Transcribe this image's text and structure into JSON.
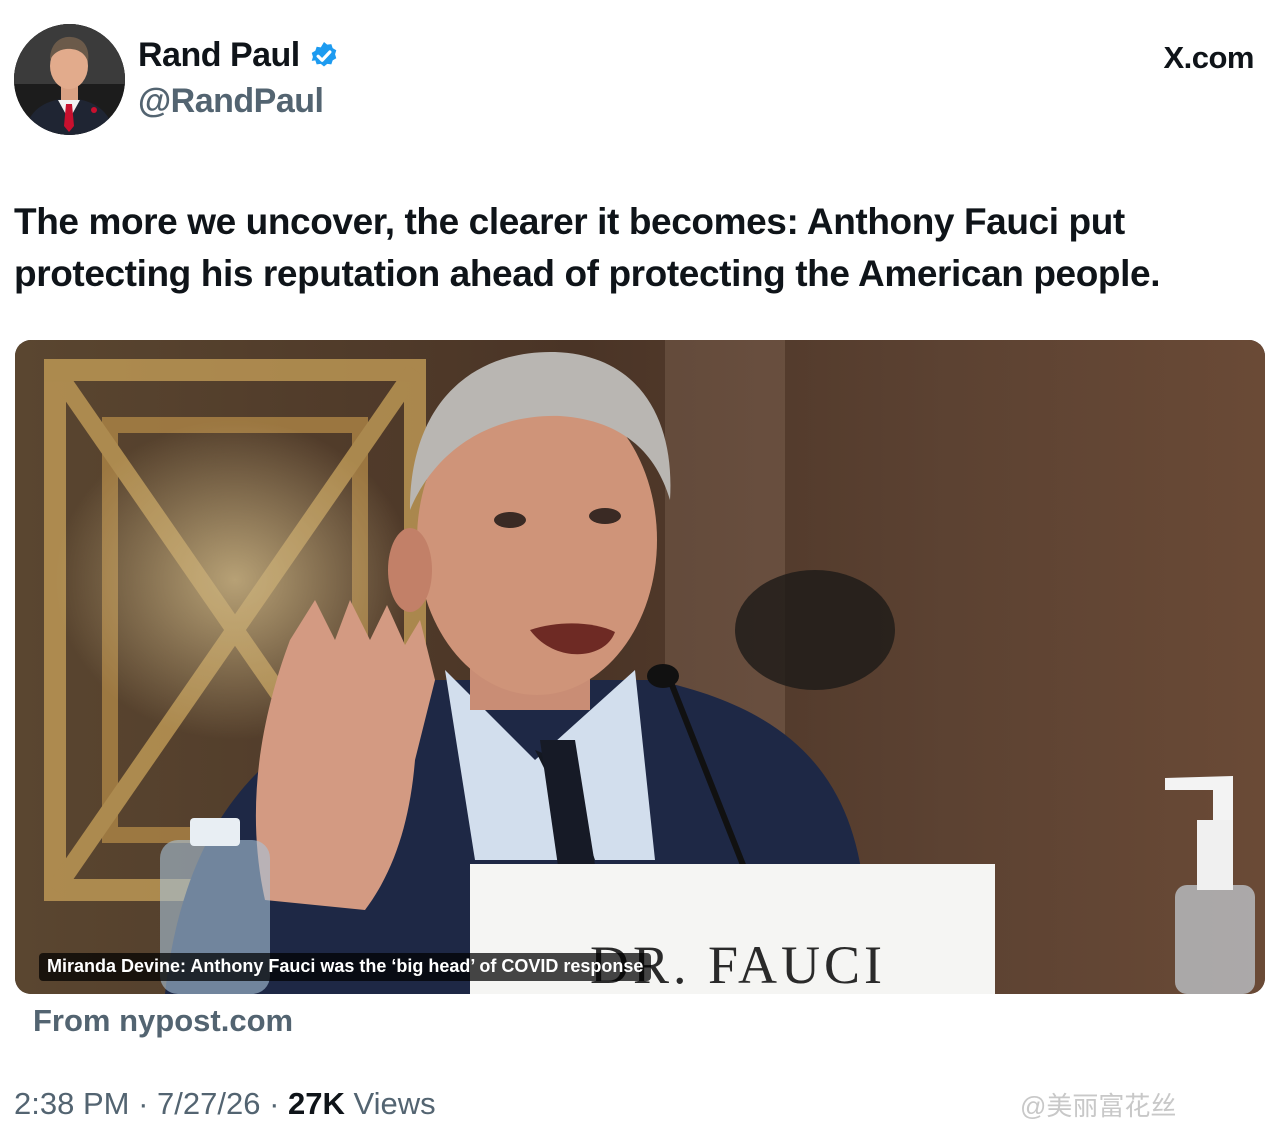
{
  "author": {
    "display_name": "Rand Paul",
    "handle": "@RandPaul",
    "verified": true,
    "verified_icon": "verified-badge-icon",
    "verified_color": "#1d9bf0"
  },
  "site": "X.com",
  "tweet": {
    "text": "The more we uncover, the clearer it becomes: Anthony Fauci put protecting his reputation ahead of protecting the American people."
  },
  "card": {
    "caption": "Miranda Devine: Anthony Fauci was the ‘big head’ of COVID response",
    "nameplate": "DR. FAUCI",
    "source": "From nypost.com"
  },
  "meta": {
    "time": "2:38 PM",
    "date": "7/27/26",
    "views_count": "27K",
    "views_label": "Views"
  },
  "watermark": "@美丽富花丝"
}
